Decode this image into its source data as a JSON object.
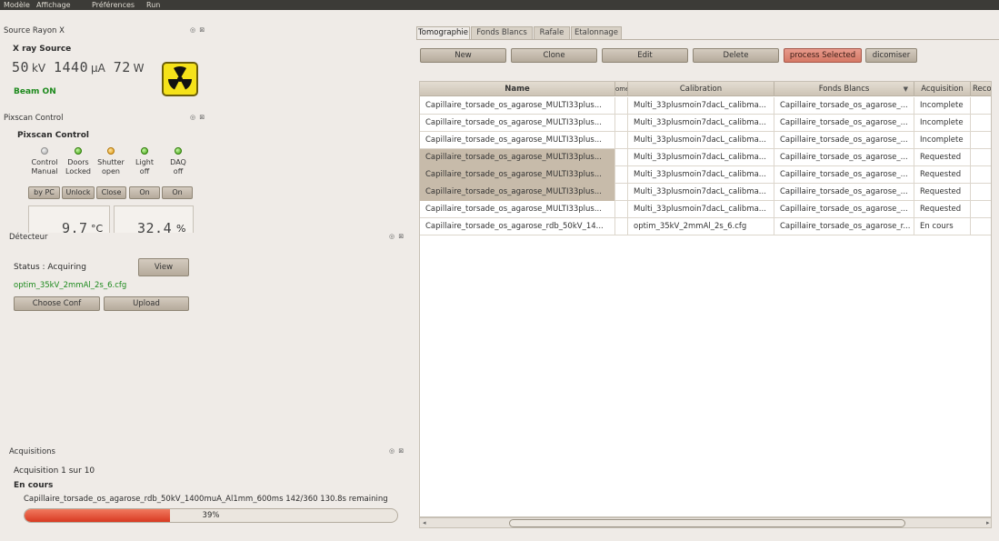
{
  "menubar": {
    "items": [
      {
        "label": "Modèle"
      },
      {
        "label": "Affichage"
      },
      {
        "label": "Préférences"
      },
      {
        "label": "Run"
      }
    ]
  },
  "source_rayon_x": {
    "dock_title": "Source Rayon X",
    "dock_buttons": "◎ ⊠",
    "title": "X ray Source",
    "kv_value": "50",
    "kv_unit": "kV",
    "ua_value": "1440",
    "ua_unit": "µA",
    "w_value": "72",
    "w_unit": "W",
    "beam_status": "Beam ON"
  },
  "pixscan": {
    "dock_title": "Pixscan Control",
    "dock_buttons": "◎ ⊠",
    "title": "Pixscan Control",
    "columns": [
      {
        "label": "Control",
        "state": "Manual",
        "button": "by PC",
        "led": "grey"
      },
      {
        "label": "Doors",
        "state": "Locked",
        "button": "Unlock",
        "led": "green"
      },
      {
        "label": "Shutter",
        "state": "open",
        "button": "Close",
        "led": "orange"
      },
      {
        "label": "Light",
        "state": "off",
        "button": "On",
        "led": "green"
      },
      {
        "label": "DAQ",
        "state": "off",
        "button": "On",
        "led": "green"
      }
    ],
    "temperature_value": "9.7",
    "temperature_unit": "°C",
    "humidity_value": "32.4",
    "humidity_unit": "%"
  },
  "detecteur": {
    "dock_title": "Détecteur",
    "dock_buttons": "◎ ⊠",
    "status": "Status : Acquiring",
    "view_button": "View",
    "config_file": "optim_35kV_2mmAl_2s_6.cfg",
    "choose_conf_button": "Choose Conf",
    "upload_button": "Upload"
  },
  "acquisitions": {
    "dock_title": "Acquisitions",
    "dock_buttons": "◎ ⊠",
    "counter": "Acquisition 1 sur 10",
    "state": "En cours",
    "detail": "Capillaire_torsade_os_agarose_rdb_50kV_1400muA_Al1mm_600ms 142/360 130.8s remaining",
    "progress_percent": 39,
    "progress_label": "39%"
  },
  "tabs": [
    {
      "label": "Tomographie",
      "active": true
    },
    {
      "label": "Fonds Blancs",
      "active": false
    },
    {
      "label": "Rafale",
      "active": false
    },
    {
      "label": "Etalonnage",
      "active": false
    }
  ],
  "toolbar": {
    "new": "New",
    "clone": "Clone",
    "edit": "Edit",
    "delete": "Delete",
    "process_selected": "process Selected",
    "dicomiser": "dicomiser"
  },
  "table": {
    "headers": {
      "name": "Name",
      "comment": "ome",
      "calibration": "Calibration",
      "fonds_blancs": "Fonds Blancs",
      "fonds_blancs_arrow": "▼",
      "acquisition": "Acquisition",
      "recon": "Recon"
    },
    "rows": [
      {
        "name": "Capillaire_torsade_os_agarose_MULTI33plus...",
        "calibration": "Multi_33plusmoin7dacL_calibma...",
        "fonds_blancs": "Capillaire_torsade_os_agarose_...",
        "acquisition": "Incomplete",
        "selected": false
      },
      {
        "name": "Capillaire_torsade_os_agarose_MULTI33plus...",
        "calibration": "Multi_33plusmoin7dacL_calibma...",
        "fonds_blancs": "Capillaire_torsade_os_agarose_...",
        "acquisition": "Incomplete",
        "selected": false
      },
      {
        "name": "Capillaire_torsade_os_agarose_MULTI33plus...",
        "calibration": "Multi_33plusmoin7dacL_calibma...",
        "fonds_blancs": "Capillaire_torsade_os_agarose_...",
        "acquisition": "Incomplete",
        "selected": false
      },
      {
        "name": "Capillaire_torsade_os_agarose_MULTI33plus...",
        "calibration": "Multi_33plusmoin7dacL_calibma...",
        "fonds_blancs": "Capillaire_torsade_os_agarose_...",
        "acquisition": "Requested",
        "selected": true
      },
      {
        "name": "Capillaire_torsade_os_agarose_MULTI33plus...",
        "calibration": "Multi_33plusmoin7dacL_calibma...",
        "fonds_blancs": "Capillaire_torsade_os_agarose_...",
        "acquisition": "Requested",
        "selected": true
      },
      {
        "name": "Capillaire_torsade_os_agarose_MULTI33plus...",
        "calibration": "Multi_33plusmoin7dacL_calibma...",
        "fonds_blancs": "Capillaire_torsade_os_agarose_...",
        "acquisition": "Requested",
        "selected": true
      },
      {
        "name": "Capillaire_torsade_os_agarose_MULTI33plus...",
        "calibration": "Multi_33plusmoin7dacL_calibma...",
        "fonds_blancs": "Capillaire_torsade_os_agarose_...",
        "acquisition": "Requested",
        "selected": false
      },
      {
        "name": "Capillaire_torsade_os_agarose_rdb_50kV_14...",
        "calibration": "optim_35kV_2mmAl_2s_6.cfg",
        "fonds_blancs": "Capillaire_torsade_os_agarose_r...",
        "acquisition": "En cours",
        "selected": false
      }
    ]
  },
  "colors": {
    "menubar_bg": "#3c3b37",
    "window_bg": "#efebe7",
    "beam_on": "#1d8a1d",
    "process_button": "#d57865",
    "progress_fill": "#d83a22",
    "selected_row": "#c7bbaa"
  }
}
